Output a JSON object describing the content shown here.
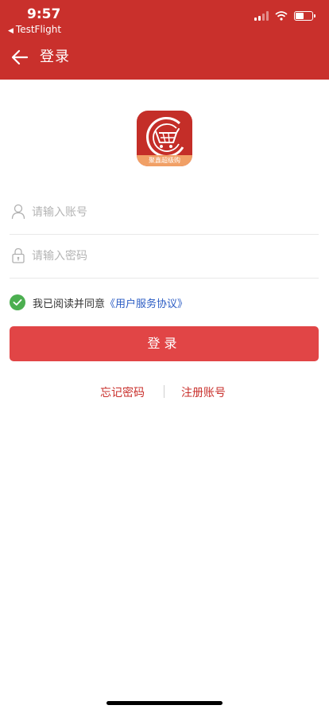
{
  "status_bar": {
    "time": "9:57",
    "back_app": "TestFlight",
    "icons": [
      "signal-icon",
      "wifi-icon",
      "battery-icon"
    ]
  },
  "nav": {
    "title": "登录",
    "back_icon": "arrow-left-icon"
  },
  "logo": {
    "banner_text": "聚鑫超级购"
  },
  "form": {
    "account_placeholder": "请输入账号",
    "password_placeholder": "请输入密码",
    "account_icon": "user-icon",
    "password_icon": "lock-icon"
  },
  "agreement": {
    "checked": true,
    "text": "我已阅读并同意",
    "link": "《用户服务协议》"
  },
  "login_button": "登录",
  "links": {
    "forgot": "忘记密码",
    "register": "注册账号"
  },
  "colors": {
    "primary": "#c9302c",
    "button": "#e14546",
    "check": "#4caf50",
    "link": "#2b5cc4"
  }
}
